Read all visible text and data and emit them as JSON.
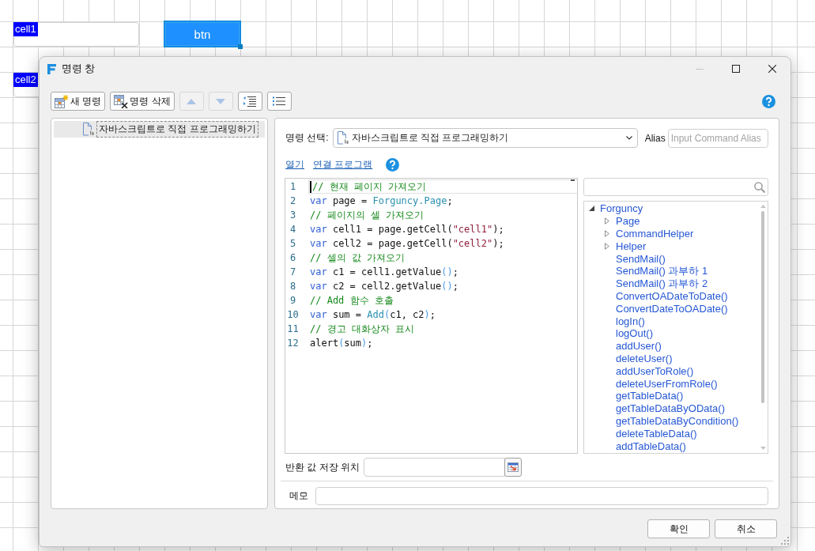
{
  "canvas": {
    "cells": [
      {
        "name": "cell1"
      },
      {
        "name": "cell2"
      }
    ],
    "button": {
      "label": "btn",
      "selected": true
    }
  },
  "dialog": {
    "title": "명령 창",
    "window_controls": [
      {
        "kind": "minimize",
        "disabled": true
      },
      {
        "kind": "maximize",
        "disabled": false
      },
      {
        "kind": "close",
        "disabled": false
      }
    ],
    "toolbar": [
      {
        "kind": "new",
        "label": "새 명령",
        "disabled": false
      },
      {
        "kind": "delete",
        "label": "명령 삭제",
        "disabled": false
      },
      {
        "kind": "up",
        "disabled": true
      },
      {
        "kind": "down",
        "disabled": true
      },
      {
        "kind": "indent",
        "disabled": false
      },
      {
        "kind": "list",
        "disabled": false
      }
    ],
    "command_list": [
      {
        "label": "자바스크립트로 직접 프로그래밍하기",
        "selected": true
      }
    ],
    "command_select": {
      "label": "명령 선택:",
      "value": "자바스크립트로 직접 프로그래밍하기"
    },
    "alias": {
      "label": "Alias",
      "placeholder": "Input Command Alias"
    },
    "links": [
      "열기",
      "연결 프로그램"
    ],
    "editor": {
      "lines": [
        {
          "number": "1",
          "current": true,
          "tokens": [
            {
              "kind": "comment",
              "text": "// 현재 페이지 가져오기"
            }
          ]
        },
        {
          "number": "2",
          "current": false,
          "tokens": [
            {
              "kind": "keyword",
              "text": "var"
            },
            {
              "kind": "plain",
              "text": " page = "
            },
            {
              "kind": "type",
              "text": "Forguncy.Page"
            },
            {
              "kind": "plain",
              "text": ";"
            }
          ]
        },
        {
          "number": "3",
          "current": false,
          "tokens": [
            {
              "kind": "comment",
              "text": "// 페이지의 셀 가져오기"
            }
          ]
        },
        {
          "number": "4",
          "current": false,
          "tokens": [
            {
              "kind": "keyword",
              "text": "var"
            },
            {
              "kind": "plain",
              "text": " cell1 = page.getCell("
            },
            {
              "kind": "string",
              "text": "\"cell1\""
            },
            {
              "kind": "plain",
              "text": ");"
            }
          ]
        },
        {
          "number": "5",
          "current": false,
          "tokens": [
            {
              "kind": "keyword",
              "text": "var"
            },
            {
              "kind": "plain",
              "text": " cell2 = page.getCell("
            },
            {
              "kind": "string",
              "text": "\"cell2\""
            },
            {
              "kind": "plain",
              "text": ");"
            }
          ]
        },
        {
          "number": "6",
          "current": false,
          "tokens": [
            {
              "kind": "comment",
              "text": "// 셀의 값 가져오기"
            }
          ]
        },
        {
          "number": "7",
          "current": false,
          "tokens": [
            {
              "kind": "keyword",
              "text": "var"
            },
            {
              "kind": "plain",
              "text": " c1 = cell1.getValue"
            },
            {
              "kind": "paren",
              "text": "()"
            },
            {
              "kind": "plain",
              "text": ";"
            }
          ]
        },
        {
          "number": "8",
          "current": false,
          "tokens": [
            {
              "kind": "keyword",
              "text": "var"
            },
            {
              "kind": "plain",
              "text": " c2 = cell2.getValue"
            },
            {
              "kind": "paren",
              "text": "()"
            },
            {
              "kind": "plain",
              "text": ";"
            }
          ]
        },
        {
          "number": "9",
          "current": false,
          "tokens": [
            {
              "kind": "comment",
              "text": "// Add 함수 호출"
            }
          ]
        },
        {
          "number": "10",
          "current": false,
          "tokens": [
            {
              "kind": "keyword",
              "text": "var"
            },
            {
              "kind": "plain",
              "text": " sum = "
            },
            {
              "kind": "type",
              "text": "Add"
            },
            {
              "kind": "paren",
              "text": "("
            },
            {
              "kind": "plain",
              "text": "c1, c2"
            },
            {
              "kind": "paren",
              "text": ")"
            },
            {
              "kind": "plain",
              "text": ";"
            }
          ]
        },
        {
          "number": "11",
          "current": false,
          "tokens": [
            {
              "kind": "comment",
              "text": "// 경고 대화상자 표시"
            }
          ]
        },
        {
          "number": "12",
          "current": false,
          "tokens": [
            {
              "kind": "plain",
              "text": "alert"
            },
            {
              "kind": "paren",
              "text": "("
            },
            {
              "kind": "plain",
              "text": "sum"
            },
            {
              "kind": "paren",
              "text": ")"
            },
            {
              "kind": "plain",
              "text": ";"
            }
          ]
        }
      ]
    },
    "api_tree": [
      {
        "label": "Forguncy",
        "expanded": true,
        "children": [
          {
            "label": "Page",
            "expanded": false
          },
          {
            "label": "CommandHelper",
            "expanded": false
          },
          {
            "label": "Helper",
            "expanded": false
          },
          {
            "label": "SendMail()"
          },
          {
            "label": "SendMail() 과부하 1"
          },
          {
            "label": "SendMail() 과부하 2"
          },
          {
            "label": "ConvertOADateToDate()"
          },
          {
            "label": "ConvertDateToOADate()"
          },
          {
            "label": "logIn()"
          },
          {
            "label": "logOut()"
          },
          {
            "label": "addUser()"
          },
          {
            "label": "deleteUser()"
          },
          {
            "label": "addUserToRole()"
          },
          {
            "label": "deleteUserFromRole()"
          },
          {
            "label": "getTableData()"
          },
          {
            "label": "getTableDataByOData()"
          },
          {
            "label": "getTableDataByCondition()"
          },
          {
            "label": "deleteTableData()"
          },
          {
            "label": "addTableData()"
          }
        ]
      }
    ],
    "return_value": {
      "label": "반환 값 저장 위치"
    },
    "memo": {
      "label": "메모"
    },
    "buttons": [
      "확인",
      "취소"
    ]
  }
}
